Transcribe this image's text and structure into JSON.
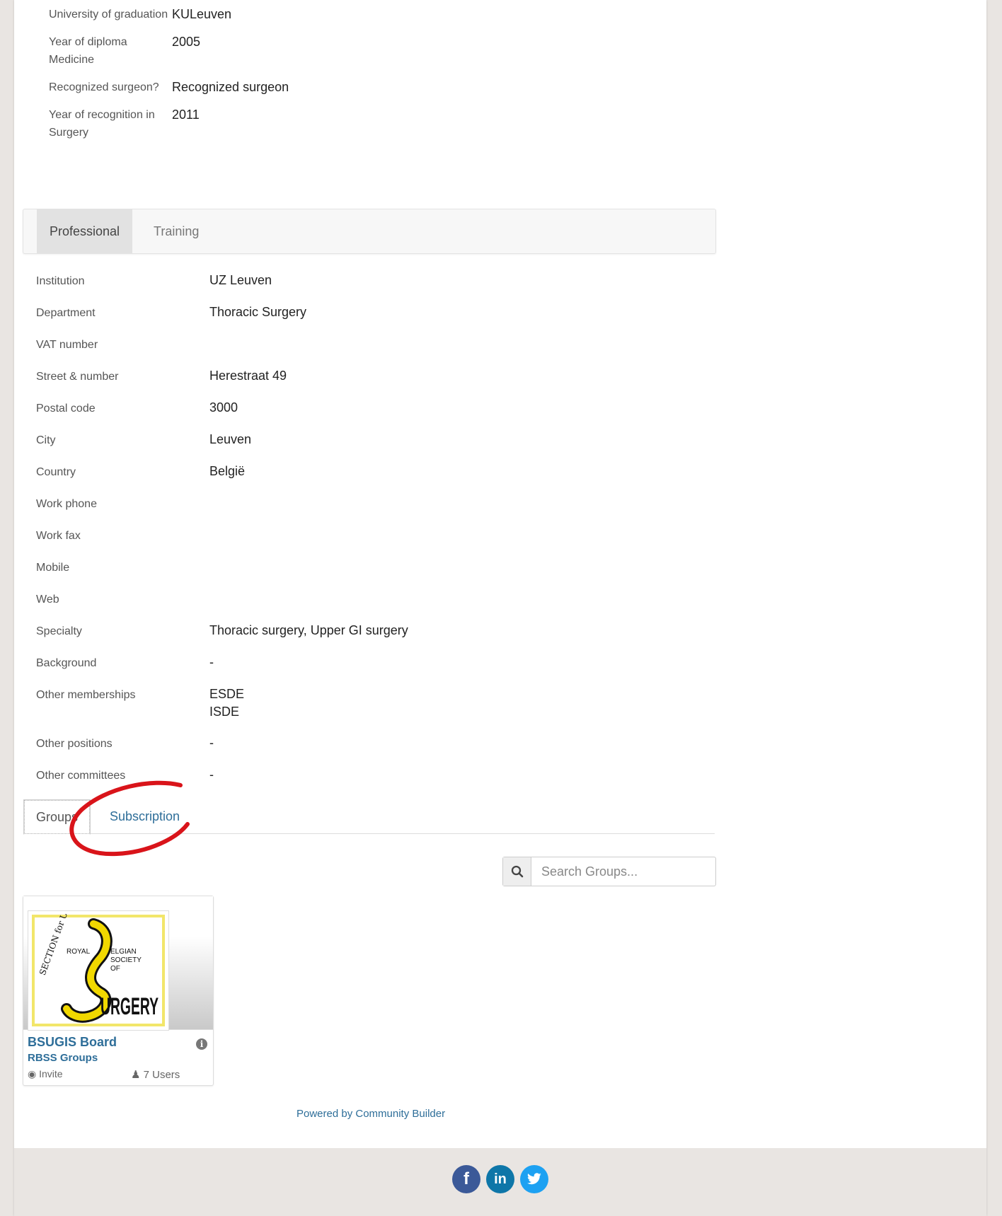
{
  "personal": [
    {
      "label": "University of graduation",
      "value": "KULeuven"
    },
    {
      "label": "Year of diploma Medicine",
      "value": "2005"
    },
    {
      "label": "Recognized surgeon?",
      "value": "Recognized surgeon"
    },
    {
      "label": "Year of recognition in Surgery",
      "value": "2011"
    }
  ],
  "tabs": {
    "professional": "Professional",
    "training": "Training"
  },
  "professional": [
    {
      "label": "Institution",
      "value": "UZ Leuven"
    },
    {
      "label": "Department",
      "value": "Thoracic Surgery"
    },
    {
      "label": "VAT number",
      "value": ""
    },
    {
      "label": "Street & number",
      "value": "Herestraat 49"
    },
    {
      "label": "Postal code",
      "value": "3000"
    },
    {
      "label": "City",
      "value": "Leuven"
    },
    {
      "label": "Country",
      "value": "België"
    },
    {
      "label": "Work phone",
      "value": ""
    },
    {
      "label": "Work fax",
      "value": ""
    },
    {
      "label": "Mobile",
      "value": ""
    },
    {
      "label": "Web",
      "value": ""
    },
    {
      "label": "Specialty",
      "value": "Thoracic surgery, Upper GI surgery"
    },
    {
      "label": "Background",
      "value": "-"
    },
    {
      "label": "Other memberships",
      "value": "ESDE",
      "value2": "ISDE"
    },
    {
      "label": "Other positions",
      "value": "-"
    },
    {
      "label": "Other committees",
      "value": "-"
    }
  ],
  "tabs2": {
    "groups": "Groups",
    "subscription": "Subscription"
  },
  "search": {
    "placeholder": "Search Groups..."
  },
  "group": {
    "title": "BSUGIS Board",
    "category": "RBSS Groups",
    "invite": "Invite",
    "users": "7 Users",
    "logo_text": {
      "arc": "SECTION for UPPER G.I.",
      "royal": "ROYAL",
      "belgian": "ELGIAN",
      "society": "SOCIETY",
      "of": "OF",
      "surgery": "URGERY"
    }
  },
  "powered": "Powered by Community Builder",
  "social": [
    {
      "name": "facebook",
      "glyph": "f",
      "color": "#3b5998"
    },
    {
      "name": "linkedin",
      "glyph": "in",
      "color": "#0e76a8"
    },
    {
      "name": "twitter",
      "glyph": "t",
      "color": "#1da1f2"
    }
  ],
  "colors": {
    "link": "#2e6e99",
    "annotation": "#d9141a",
    "footer_bg": "#e9e5e2"
  }
}
